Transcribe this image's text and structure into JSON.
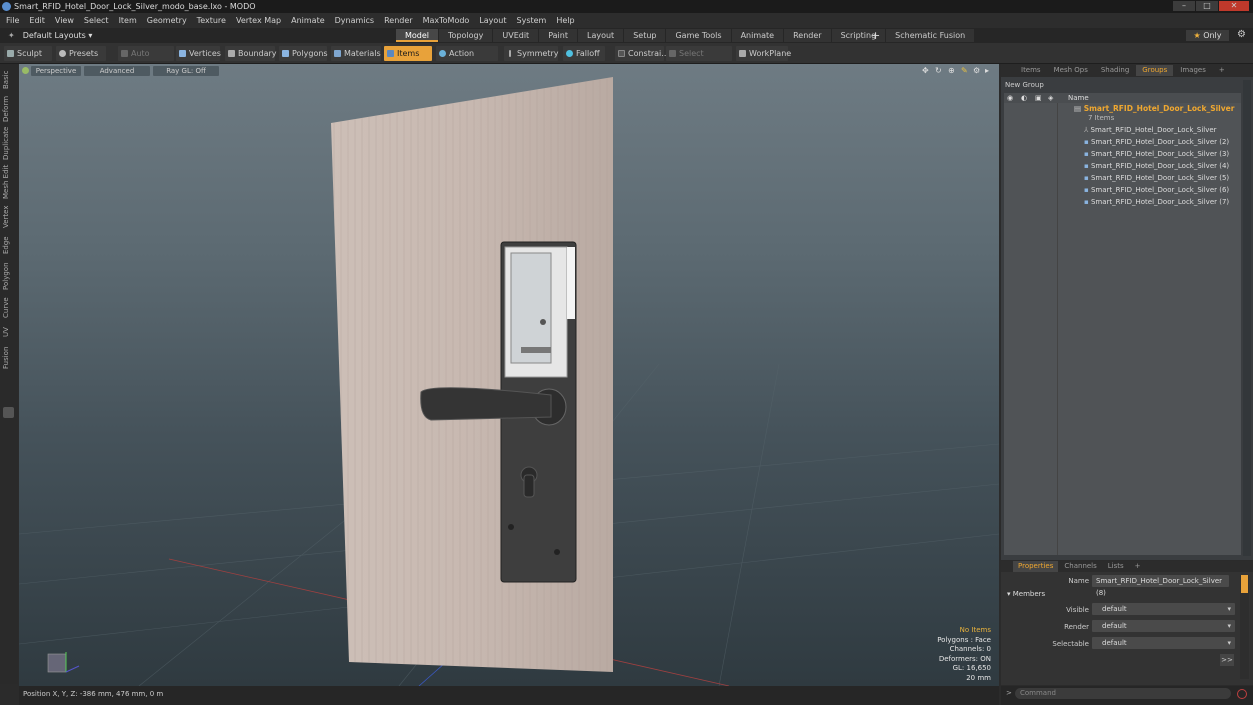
{
  "window": {
    "title": "Smart_RFID_Hotel_Door_Lock_Silver_modo_base.lxo - MODO"
  },
  "menu": [
    "File",
    "Edit",
    "View",
    "Select",
    "Item",
    "Geometry",
    "Texture",
    "Vertex Map",
    "Animate",
    "Dynamics",
    "Render",
    "MaxToModo",
    "Layout",
    "System",
    "Help"
  ],
  "layouts": {
    "label": "Default Layouts ▾"
  },
  "mode_tabs": [
    "Model",
    "Topology",
    "UVEdit",
    "Paint",
    "Layout",
    "Setup",
    "Game Tools",
    "Animate",
    "Render",
    "Scripting",
    "Schematic Fusion"
  ],
  "active_mode_tab": "Model",
  "only_button": {
    "star": "★",
    "label": "Only"
  },
  "toolbar": {
    "sculpt": "Sculpt",
    "presets": "Presets",
    "auto_select": "Auto Select",
    "vertices": "Vertices",
    "boundary": "Boundary",
    "polygons": "Polygons",
    "materials": "Materials",
    "items": "Items",
    "action_center": "Action Center",
    "symmetry": "Symmetry",
    "falloff": "Falloff",
    "constrain": "Constrai...",
    "select_through": "Select Through",
    "workplane": "WorkPlane"
  },
  "left_tabs": [
    "Basic",
    "Deform",
    "Duplicate",
    "Mesh Edit",
    "Vertex",
    "Edge",
    "Polygon",
    "Curve",
    "UV",
    "Fusion"
  ],
  "viewport": {
    "perspective": "Perspective",
    "advanced": "Advanced",
    "raygl": "Ray GL: Off",
    "stats": {
      "no_items": "No Items",
      "polygons": "Polygons : Face",
      "channels": "Channels: 0",
      "deformers": "Deformers: ON",
      "gl": "GL: 16,650",
      "size": "20 mm"
    }
  },
  "status": {
    "position": "Position X, Y, Z:   -386 mm, 476 mm, 0 m"
  },
  "right_panel": {
    "tabs": [
      "Items",
      "Mesh Ops",
      "Shading",
      "Groups",
      "Images"
    ],
    "active_tab": "Groups",
    "new_group": "New Group",
    "col_name": "Name",
    "root": {
      "name": "Smart_RFID_Hotel_Door_Lock_Silver",
      "count": "7 Items"
    },
    "items": [
      "Smart_RFID_Hotel_Door_Lock_Silver",
      "Smart_RFID_Hotel_Door_Lock_Silver (2)",
      "Smart_RFID_Hotel_Door_Lock_Silver (3)",
      "Smart_RFID_Hotel_Door_Lock_Silver (4)",
      "Smart_RFID_Hotel_Door_Lock_Silver (5)",
      "Smart_RFID_Hotel_Door_Lock_Silver (6)",
      "Smart_RFID_Hotel_Door_Lock_Silver (7)"
    ]
  },
  "properties": {
    "tabs": [
      "Properties",
      "Channels",
      "Lists"
    ],
    "active_tab": "Properties",
    "name_label": "Name",
    "name_value": "Smart_RFID_Hotel_Door_Lock_Silver (8)",
    "members": "Members",
    "visible_label": "Visible",
    "visible_value": "default",
    "render_label": "Render",
    "render_value": "default",
    "selectable_label": "Selectable",
    "selectable_value": "default",
    "expand": ">>"
  },
  "command": {
    "placeholder": "Command"
  }
}
